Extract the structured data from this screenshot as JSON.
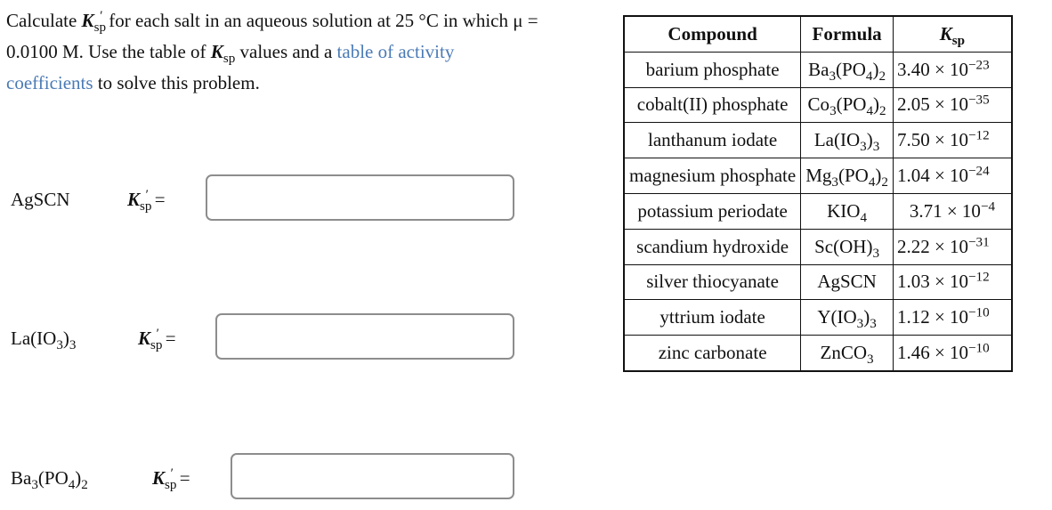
{
  "prompt": {
    "part1": "Calculate ",
    "kprime_symbol": "K",
    "kprime_sub": "sp",
    "prime": "′",
    "part2": " for each salt in an aqueous solution at 25 °C in which μ = 0.0100 M. Use the table of ",
    "k_symbol": "K",
    "k_sub": "sp",
    "part3": " values and a ",
    "link_text": "table of activity coefficients",
    "part4": " to solve this problem.",
    "link_color": "#4a7ab5"
  },
  "answers": [
    {
      "salt": {
        "parts": [
          {
            "t": "AgSCN"
          }
        ]
      },
      "k_symbol": "K",
      "k_sub": "sp",
      "prime": "′",
      "equals": "=",
      "value": ""
    },
    {
      "salt": {
        "parts": [
          {
            "t": "La(IO"
          },
          {
            "sub": "3"
          },
          {
            "t": ")"
          },
          {
            "sub": "3"
          }
        ]
      },
      "k_symbol": "K",
      "k_sub": "sp",
      "prime": "′",
      "equals": "=",
      "value": ""
    },
    {
      "salt": {
        "parts": [
          {
            "t": "Ba"
          },
          {
            "sub": "3"
          },
          {
            "t": "(PO"
          },
          {
            "sub": "4"
          },
          {
            "t": ")"
          },
          {
            "sub": "2"
          }
        ]
      },
      "k_symbol": "K",
      "k_sub": "sp",
      "prime": "′",
      "equals": "=",
      "value": ""
    }
  ],
  "table": {
    "headers": {
      "compound": "Compound",
      "formula": "Formula",
      "k_symbol": "K",
      "k_sub": "sp"
    },
    "rows": [
      {
        "compound": "barium phosphate",
        "formula": [
          {
            "t": "Ba"
          },
          {
            "sub": "3"
          },
          {
            "t": "(PO"
          },
          {
            "sub": "4"
          },
          {
            "t": ")"
          },
          {
            "sub": "2"
          }
        ],
        "mantissa": "3.40",
        "exponent": "−23"
      },
      {
        "compound": "cobalt(II) phosphate",
        "formula": [
          {
            "t": "Co"
          },
          {
            "sub": "3"
          },
          {
            "t": "(PO"
          },
          {
            "sub": "4"
          },
          {
            "t": ")"
          },
          {
            "sub": "2"
          }
        ],
        "mantissa": "2.05",
        "exponent": "−35"
      },
      {
        "compound": "lanthanum iodate",
        "formula": [
          {
            "t": "La(IO"
          },
          {
            "sub": "3"
          },
          {
            "t": ")"
          },
          {
            "sub": "3"
          }
        ],
        "mantissa": "7.50",
        "exponent": "−12"
      },
      {
        "compound": "magnesium phosphate",
        "formula": [
          {
            "t": "Mg"
          },
          {
            "sub": "3"
          },
          {
            "t": "(PO"
          },
          {
            "sub": "4"
          },
          {
            "t": ")"
          },
          {
            "sub": "2"
          }
        ],
        "mantissa": "1.04",
        "exponent": "−24"
      },
      {
        "compound": "potassium periodate",
        "formula": [
          {
            "t": "KIO"
          },
          {
            "sub": "4"
          }
        ],
        "mantissa": "3.71",
        "exponent": "−4"
      },
      {
        "compound": "scandium hydroxide",
        "formula": [
          {
            "t": "Sc(OH)"
          },
          {
            "sub": "3"
          }
        ],
        "mantissa": "2.22",
        "exponent": "−31"
      },
      {
        "compound": "silver thiocyanate",
        "formula": [
          {
            "t": "AgSCN"
          }
        ],
        "mantissa": "1.03",
        "exponent": "−12"
      },
      {
        "compound": "yttrium iodate",
        "formula": [
          {
            "t": "Y(IO"
          },
          {
            "sub": "3"
          },
          {
            "t": ")"
          },
          {
            "sub": "3"
          }
        ],
        "mantissa": "1.12",
        "exponent": "−10"
      },
      {
        "compound": "zinc carbonate",
        "formula": [
          {
            "t": "ZnCO"
          },
          {
            "sub": "3"
          }
        ],
        "mantissa": "1.46",
        "exponent": "−10"
      }
    ],
    "times": "×",
    "base": "10"
  }
}
